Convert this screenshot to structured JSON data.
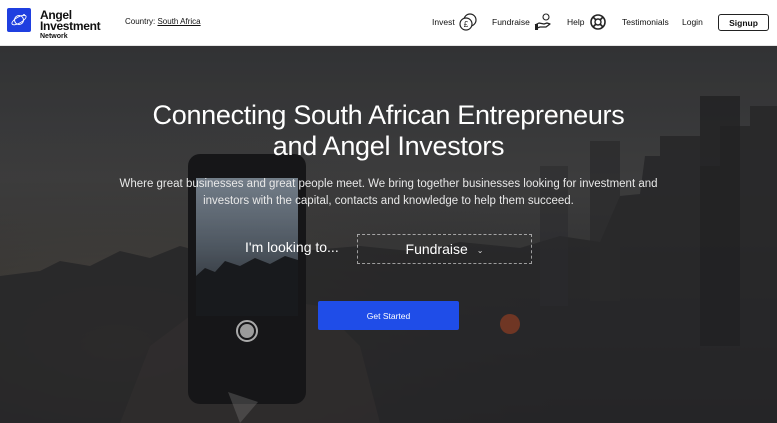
{
  "brand": {
    "line1": "Angel",
    "line2": "Investment",
    "line3": "Network",
    "color": "#1f3fe0"
  },
  "country": {
    "label": "Country:",
    "value": "South Africa"
  },
  "nav": {
    "invest": "Invest",
    "fundraise": "Fundraise",
    "help": "Help",
    "testimonials": "Testimonials",
    "login": "Login",
    "signup": "Signup"
  },
  "hero": {
    "title_line1": "Connecting South African Entrepreneurs",
    "title_line2": "and Angel Investors",
    "subtitle": "Where great businesses and great people meet. We bring together businesses looking for investment and investors with the capital, contacts and knowledge to help them succeed.",
    "looking_label": "I'm looking to...",
    "select_value": "Fundraise",
    "cta": "Get Started",
    "cta_color": "#1f4de8"
  }
}
